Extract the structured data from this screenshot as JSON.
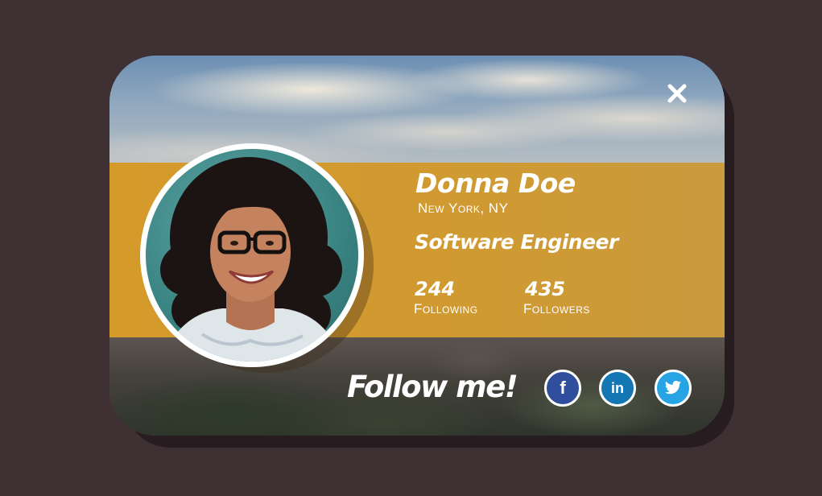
{
  "profile": {
    "name": "Donna Doe",
    "location": "New York, NY",
    "job_title": "Software Engineer"
  },
  "stats": {
    "following": {
      "count": "244",
      "label": "Following"
    },
    "followers": {
      "count": "435",
      "label": "Followers"
    }
  },
  "follow": {
    "heading": "Follow me!",
    "networks": [
      {
        "name": "facebook",
        "icon": "facebook-icon",
        "glyph": "f",
        "color": "#2f4f9c"
      },
      {
        "name": "linkedin",
        "icon": "linkedin-icon",
        "glyph": "in",
        "color": "#1576b4"
      },
      {
        "name": "twitter",
        "icon": "twitter-icon",
        "glyph": "",
        "color": "#27a4e3"
      }
    ]
  },
  "icons": {
    "close": "close-icon"
  },
  "colors": {
    "page_background": "#3f3033",
    "accent_band": "#d49a2a",
    "text": "#ffffff"
  }
}
